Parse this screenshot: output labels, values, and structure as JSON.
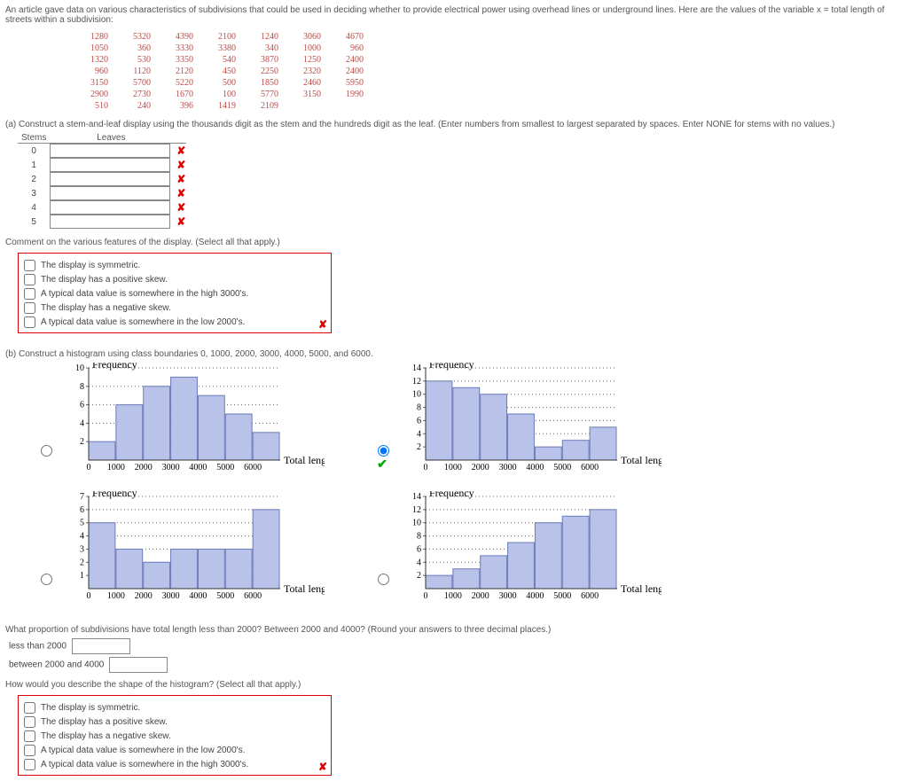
{
  "intro": "An article gave data on various characteristics of subdivisions that could be used in deciding whether to provide electrical power using overhead lines or underground lines. Here are the values of the variable x = total length of streets within a subdivision:",
  "data_rows": [
    [
      "1280",
      "5320",
      "4390",
      "2100",
      "1240",
      "3060",
      "4670"
    ],
    [
      "1050",
      "360",
      "3330",
      "3380",
      "340",
      "1000",
      "960"
    ],
    [
      "1320",
      "530",
      "3350",
      "540",
      "3870",
      "1250",
      "2400"
    ],
    [
      "960",
      "1120",
      "2120",
      "450",
      "2250",
      "2320",
      "2400"
    ],
    [
      "3150",
      "5700",
      "5220",
      "500",
      "1850",
      "2460",
      "5950"
    ],
    [
      "2900",
      "2730",
      "1670",
      "100",
      "5770",
      "3150",
      "1990"
    ],
    [
      "510",
      "240",
      "396",
      "1419",
      "2109",
      "",
      ""
    ]
  ],
  "part_a": "(a) Construct a stem-and-leaf display using the thousands digit as the stem and the hundreds digit as the leaf. (Enter numbers from smallest to largest separated by spaces. Enter NONE for stems with no values.)",
  "stems_header": "Stems",
  "leaves_header": "Leaves",
  "stems": [
    "0",
    "1",
    "2",
    "3",
    "4",
    "5"
  ],
  "comment_a": "Comment on the various features of the display. (Select all that apply.)",
  "cb_a": [
    "The display is symmetric.",
    "The display has a positive skew.",
    "A typical data value is somewhere in the high 3000's.",
    "The display has a negative skew.",
    "A typical data value is somewhere in the low 2000's."
  ],
  "part_b": "(b) Construct a histogram using class boundaries 0, 1000, 2000, 3000, 4000, 5000, and 6000.",
  "freq_label": "Frequency",
  "total_label": "Total length",
  "xticks": [
    "0",
    "1000",
    "2000",
    "3000",
    "4000",
    "5000",
    "6000"
  ],
  "chart_data": [
    {
      "type": "bar",
      "categories": [
        "0",
        "1000",
        "2000",
        "3000",
        "4000",
        "5000",
        "6000"
      ],
      "values": [
        2,
        6,
        8,
        9,
        7,
        5,
        3
      ],
      "xlabel": "Total length",
      "ylabel": "Frequency",
      "yticks": [
        2,
        4,
        6,
        8,
        10
      ],
      "ymax": 10,
      "selected": false
    },
    {
      "type": "bar",
      "categories": [
        "0",
        "1000",
        "2000",
        "3000",
        "4000",
        "5000",
        "6000"
      ],
      "values": [
        12,
        11,
        10,
        7,
        2,
        3,
        5
      ],
      "xlabel": "Total length",
      "ylabel": "Frequency",
      "yticks": [
        2,
        4,
        6,
        8,
        10,
        12,
        14
      ],
      "ymax": 14,
      "selected": true,
      "correct": true
    },
    {
      "type": "bar",
      "categories": [
        "0",
        "1000",
        "2000",
        "3000",
        "4000",
        "5000",
        "6000"
      ],
      "values": [
        5,
        3,
        2,
        3,
        3,
        3,
        6
      ],
      "xlabel": "Total length",
      "ylabel": "Frequency",
      "yticks": [
        1,
        2,
        3,
        4,
        5,
        6,
        7
      ],
      "ymax": 7,
      "selected": false
    },
    {
      "type": "bar",
      "categories": [
        "0",
        "1000",
        "2000",
        "3000",
        "4000",
        "5000",
        "6000"
      ],
      "values": [
        2,
        3,
        5,
        7,
        10,
        11,
        12
      ],
      "xlabel": "Total length",
      "ylabel": "Frequency",
      "yticks": [
        2,
        4,
        6,
        8,
        10,
        12,
        14
      ],
      "ymax": 14,
      "selected": false
    }
  ],
  "prop_q": "What proportion of subdivisions have total length less than 2000? Between 2000 and 4000? (Round your answers to three decimal places.)",
  "prop_lt": "less than 2000",
  "prop_bt": "between 2000 and 4000",
  "shape_q": "How would you describe the shape of the histogram? (Select all that apply.)",
  "cb_b": [
    "The display is symmetric.",
    "The display has a positive skew.",
    "The display has a negative skew.",
    "A typical data value is somewhere in the low 2000's.",
    "A typical data value is somewhere in the high 3000's."
  ]
}
